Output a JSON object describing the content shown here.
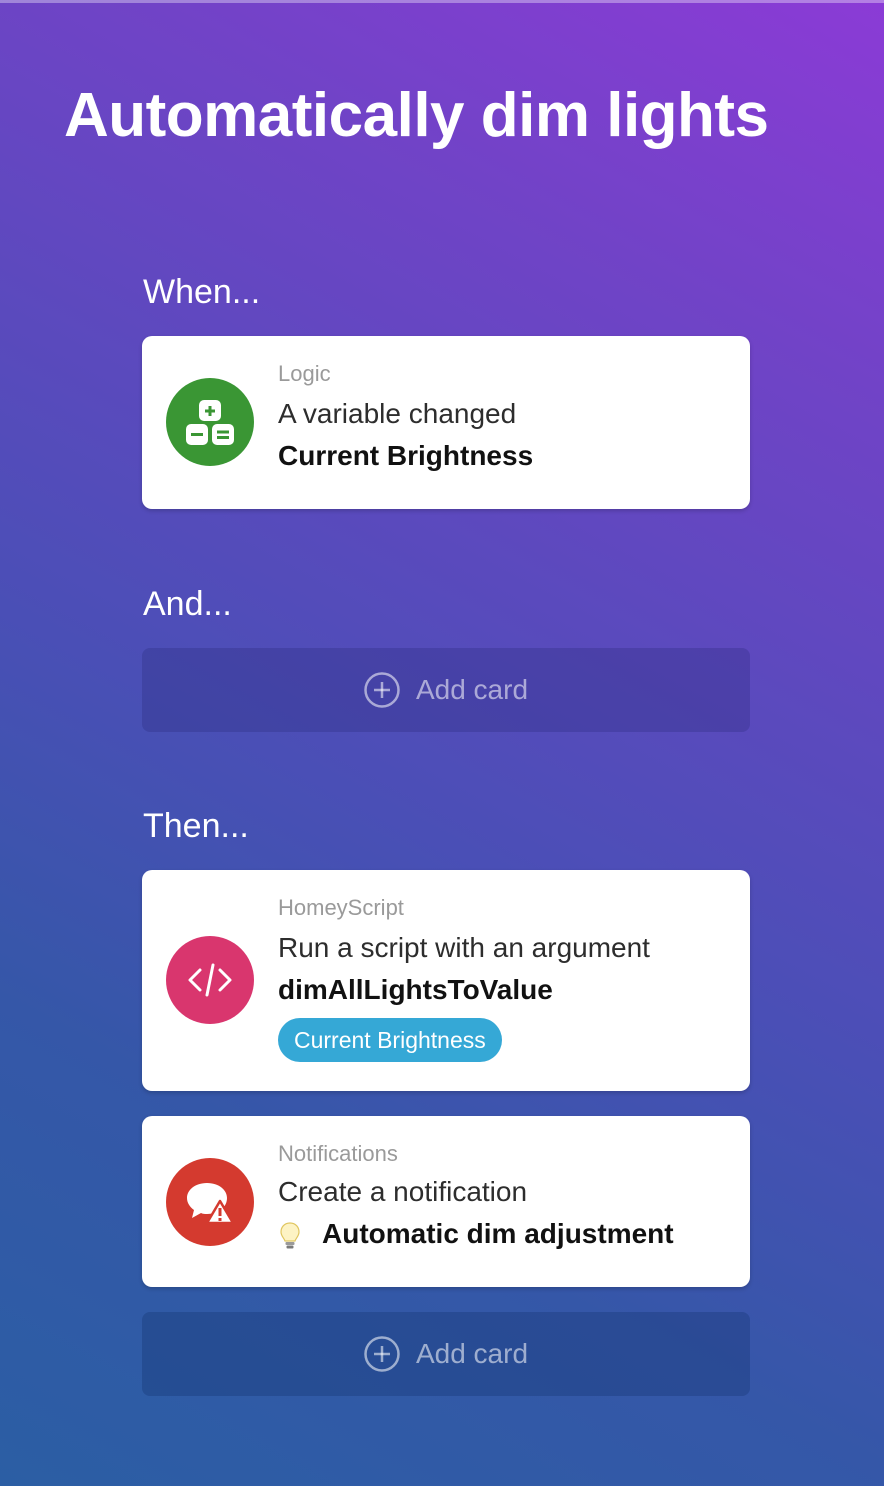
{
  "flow": {
    "title": "Automatically dim lights"
  },
  "when": {
    "label": "When...",
    "card": {
      "category": "Logic",
      "action": "A variable changed",
      "argument": "Current Brightness",
      "icon": "logic-calculator-icon",
      "icon_color": "#3a9634"
    }
  },
  "and": {
    "label": "And...",
    "add_card_label": "Add card"
  },
  "then": {
    "label": "Then...",
    "cards": [
      {
        "category": "HomeyScript",
        "action": "Run a script with an argument",
        "argument": "dimAllLightsToValue",
        "tag": "Current Brightness",
        "icon": "code-icon",
        "icon_color": "#d9366e",
        "tag_color": "#35a8d6"
      },
      {
        "category": "Notifications",
        "action": "Create a notification",
        "argument": "Automatic dim adjustment",
        "argument_icon": "lightbulb-icon",
        "icon": "notification-warning-icon",
        "icon_color": "#d43a2f"
      }
    ],
    "add_card_label": "Add card"
  }
}
